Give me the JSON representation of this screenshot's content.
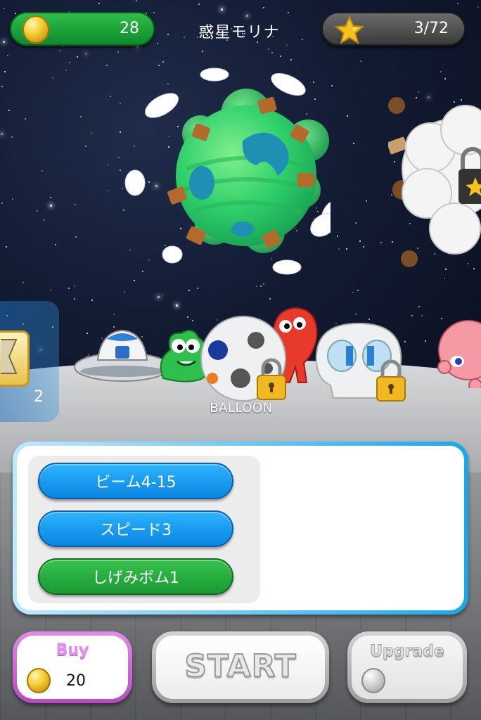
{
  "hud": {
    "coin_count": "28",
    "planet_name": "惑星モリナ",
    "star_progress": "3/72",
    "coin_icon": "coin-icon",
    "star_icon": "star-icon"
  },
  "planet": {
    "name": "惑星モリナ",
    "next_planet_locked": true
  },
  "items": {
    "hourglass": {
      "icon": "hourglass-icon",
      "count": "2"
    }
  },
  "characters": [
    {
      "name": "ufo",
      "locked": false
    },
    {
      "name": "green-alien",
      "locked": false
    },
    {
      "name": "balloon",
      "locked": true,
      "selected": true
    },
    {
      "name": "red-alien",
      "locked": false
    },
    {
      "name": "skull",
      "locked": true
    },
    {
      "name": "pink-octopus",
      "locked": false
    }
  ],
  "selected_character": {
    "label": "BALLOON"
  },
  "skills": [
    {
      "label": "ビーム4-15",
      "color": "#1aa0f5"
    },
    {
      "label": "スピード3",
      "color": "#1aa0f5"
    },
    {
      "label": "しげみボム1",
      "color": "#2eb044"
    }
  ],
  "buttons": {
    "buy_label": "Buy",
    "buy_price": "20",
    "start_label": "START",
    "upgrade_label": "Upgrade"
  },
  "colors": {
    "coin_pill": "#1a9f36",
    "star_pill": "#555555",
    "buy_border": "#c45ad0",
    "skill_panel_border": "#1aa6e6"
  }
}
